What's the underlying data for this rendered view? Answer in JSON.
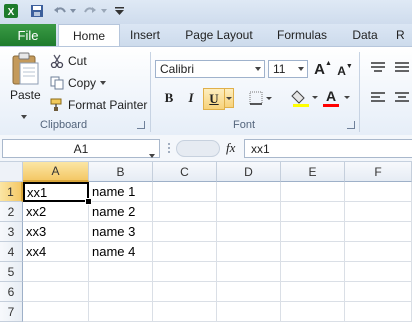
{
  "quick_access": {
    "app_icon": "excel-icon",
    "save_icon": "save-icon",
    "undo_icon": "undo-icon",
    "redo_icon": "redo-icon",
    "customize_icon": "customize-qat-icon"
  },
  "tabs": {
    "file": "File",
    "items": [
      "Home",
      "Insert",
      "Page Layout",
      "Formulas",
      "Data",
      "R"
    ],
    "active": "Home"
  },
  "clipboard": {
    "paste": "Paste",
    "cut": "Cut",
    "copy": "Copy",
    "format_painter": "Format Painter",
    "group_label": "Clipboard"
  },
  "font": {
    "family": "Calibri",
    "size": "11",
    "bold": "B",
    "italic": "I",
    "underline": "U",
    "grow": "A",
    "shrink": "A",
    "group_label": "Font",
    "fill_color": "#ffff00",
    "font_color": "#ff0000"
  },
  "formula_bar": {
    "name_box": "A1",
    "fx": "fx",
    "content": "xx1"
  },
  "sheet": {
    "columns": [
      "A",
      "B",
      "C",
      "D",
      "E",
      "F"
    ],
    "rows": [
      "1",
      "2",
      "3",
      "4",
      "5",
      "6",
      "7"
    ],
    "selected_column": "A",
    "selected_row": "1",
    "cells": {
      "A1": "xx1",
      "B1": "name 1",
      "A2": "xx2",
      "B2": "name 2",
      "A3": "xx3",
      "B3": "name 3",
      "A4": "xx4",
      "B4": "name 4"
    }
  },
  "colors": {
    "file_tab": "#1e7b2c",
    "selection_header": "#f4c866"
  }
}
